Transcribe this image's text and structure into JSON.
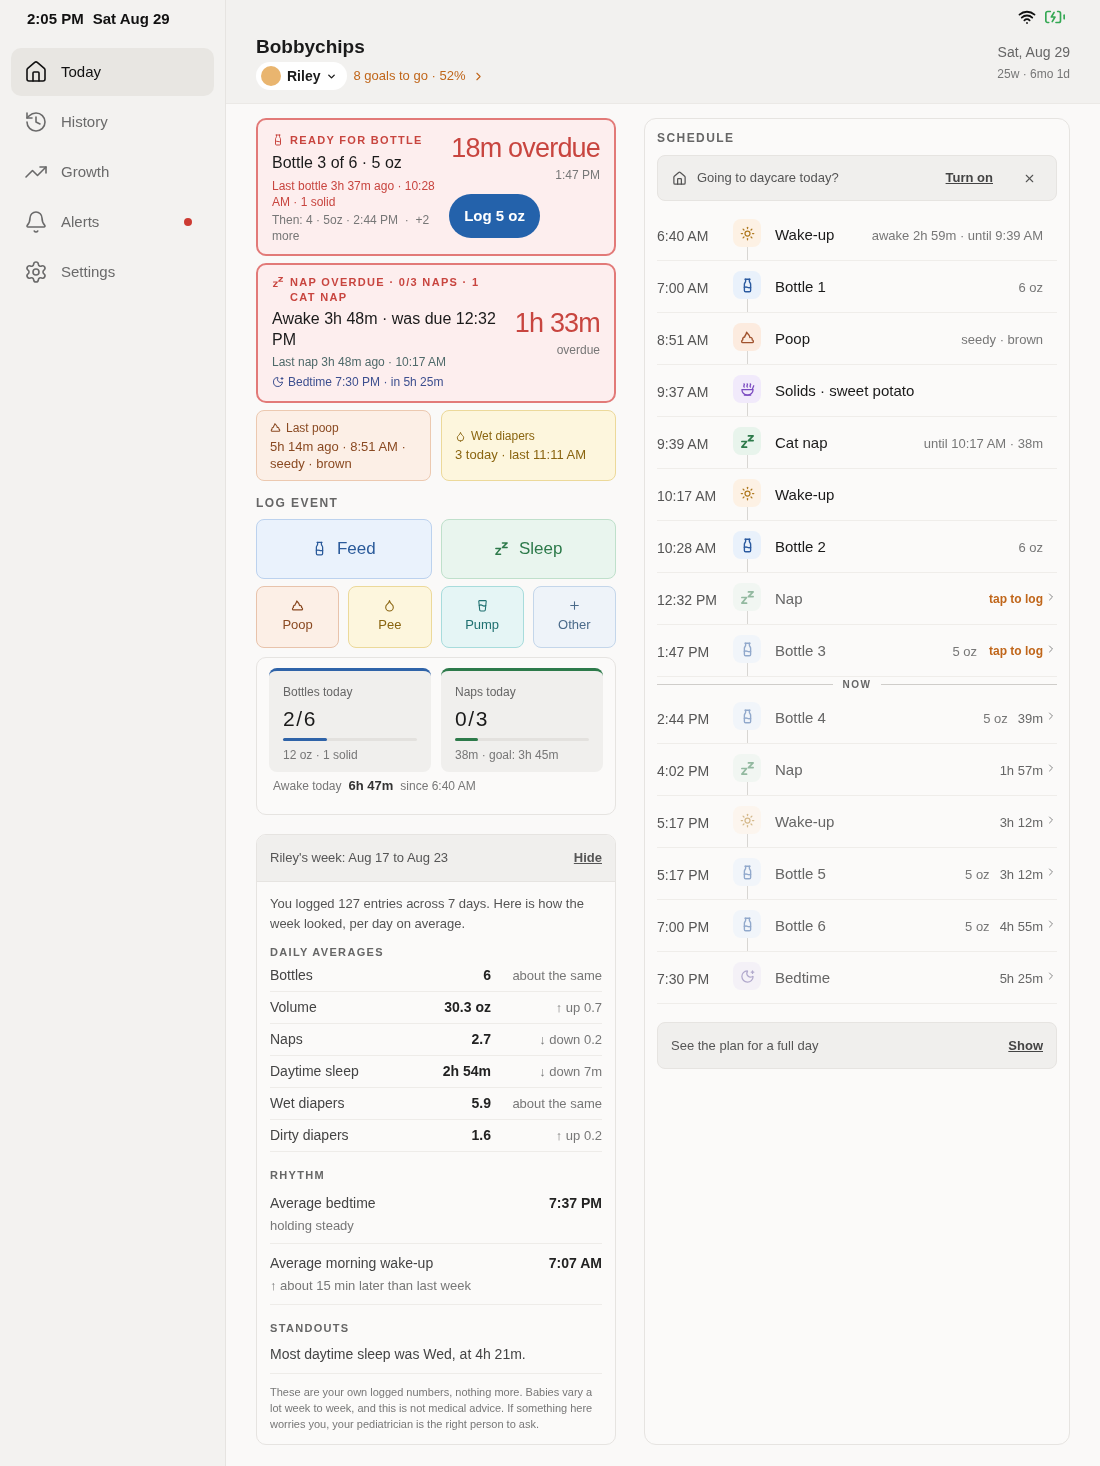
{
  "status_bar": {
    "time": "2:05 PM",
    "date": "Sat Aug 29"
  },
  "sidebar": {
    "items": [
      {
        "label": "Today",
        "selected": true,
        "alert": false
      },
      {
        "label": "History",
        "selected": false,
        "alert": false
      },
      {
        "label": "Growth",
        "selected": false,
        "alert": false
      },
      {
        "label": "Alerts",
        "selected": false,
        "alert": true
      },
      {
        "label": "Settings",
        "selected": false,
        "alert": false
      }
    ]
  },
  "header": {
    "title": "Bobbychips",
    "child": "Riley",
    "goals": "8 goals to go · 52%",
    "date": "Sat, Aug 29",
    "age": "25w · 6mo 1d"
  },
  "bottle_alert": {
    "label": "READY FOR BOTTLE",
    "title": "Bottle 3 of 6 · 5 oz",
    "detail": "Last bottle 3h 37m ago · 10:28 AM · 1 solid",
    "next": "Then: 4 · 5oz · 2:44 PM  ·  +2 more",
    "overdue": "18m overdue",
    "time": "1:47 PM",
    "button": "Log 5 oz"
  },
  "nap_alert": {
    "label": "NAP OVERDUE · 0/3 NAPS · 1 CAT NAP",
    "title": "Awake 3h 48m · was due 12:32 PM",
    "detail": "Last nap 3h 48m ago · 10:17 AM",
    "bedtime": "Bedtime 7:30 PM · in 5h 25m",
    "overdue": "1h 33m",
    "overdue_note": "overdue"
  },
  "summary_cards": [
    {
      "kind": "poop",
      "title": "Last poop",
      "text": "5h 14m ago · 8:51 AM · seedy · brown"
    },
    {
      "kind": "wet",
      "title": "Wet diapers",
      "text": "3 today · last 11:11 AM"
    }
  ],
  "log_event": {
    "heading": "LOG EVENT",
    "buttons": [
      {
        "kind": "feed",
        "label": "Feed"
      },
      {
        "kind": "sleep",
        "label": "Sleep"
      },
      {
        "kind": "poop",
        "label": "Poop"
      },
      {
        "kind": "pee",
        "label": "Pee"
      },
      {
        "kind": "pump",
        "label": "Pump"
      },
      {
        "kind": "other",
        "label": "Other"
      }
    ]
  },
  "today": {
    "tiles": [
      {
        "kind": "bottles",
        "label": "Bottles today",
        "value": "2/6",
        "level": 0.33,
        "detail": "12 oz · 1 solid"
      },
      {
        "kind": "naps",
        "label": "Naps today",
        "value": "0/3",
        "level": 0.17,
        "detail": "38m · goal: 3h 45m"
      }
    ],
    "awake_label": "Awake today",
    "awake_value": "6h 47m",
    "awake_since": "since 6:40 AM"
  },
  "week": {
    "title": "Riley's week: Aug 17 to Aug 23",
    "hide": "Hide",
    "intro": "You logged 127 entries across 7 days. Here is how the week looked, per day on average.",
    "averages_heading": "DAILY AVERAGES",
    "averages": [
      {
        "label": "Bottles",
        "value": "6",
        "change": "about the same"
      },
      {
        "label": "Volume",
        "value": "30.3 oz",
        "change": "↑ up 0.7"
      },
      {
        "label": "Naps",
        "value": "2.7",
        "change": "↓ down 0.2"
      },
      {
        "label": "Daytime sleep",
        "value": "2h 54m",
        "change": "↓ down 7m"
      },
      {
        "label": "Wet diapers",
        "value": "5.9",
        "change": "about the same"
      },
      {
        "label": "Dirty diapers",
        "value": "1.6",
        "change": "↑ up 0.2"
      }
    ],
    "rhythm_heading": "RHYTHM",
    "rhythm": [
      {
        "label": "Average bedtime",
        "note": "holding steady",
        "value": "7:37 PM"
      },
      {
        "label": "Average morning wake-up",
        "note": "↑ about 15 min later than last week",
        "value": "7:07 AM"
      }
    ],
    "standouts_heading": "STANDOUTS",
    "standout": "Most daytime sleep was Wed, at 4h 21m.",
    "disclaimer": "These are your own logged numbers, nothing more. Babies vary a lot week to week, and this is not medical advice. If something here worries you, your pediatrician is the right person to ask."
  },
  "schedule": {
    "heading": "SCHEDULE",
    "daycare": {
      "text": "Going to daycare today?",
      "action": "Turn on"
    },
    "past": [
      {
        "kind": "wake",
        "logged": true,
        "time": "6:40 AM",
        "title": "Wake-up",
        "note": "awake 2h 59m · until 9:39 AM"
      },
      {
        "kind": "bottle",
        "logged": true,
        "time": "7:00 AM",
        "title": "Bottle 1",
        "note": "6 oz"
      },
      {
        "kind": "poop",
        "logged": true,
        "time": "8:51 AM",
        "title": "Poop",
        "note": "seedy · brown"
      },
      {
        "kind": "solids",
        "logged": true,
        "time": "9:37 AM",
        "title": "Solids · sweet potato"
      },
      {
        "kind": "nap",
        "logged": true,
        "time": "9:39 AM",
        "title": "Cat nap",
        "note": "until 10:17 AM · 38m"
      },
      {
        "kind": "wake",
        "logged": true,
        "time": "10:17 AM",
        "title": "Wake-up"
      },
      {
        "kind": "bottle",
        "logged": true,
        "time": "10:28 AM",
        "title": "Bottle 2",
        "note": "6 oz"
      },
      {
        "kind": "nap",
        "logged": false,
        "time": "12:32 PM",
        "title": "Nap",
        "action": "tap to log"
      },
      {
        "kind": "bottle",
        "logged": false,
        "time": "1:47 PM",
        "title": "Bottle 3",
        "note": "5 oz",
        "action": "tap to log"
      }
    ],
    "now_label": "NOW",
    "upcoming": [
      {
        "kind": "bottle",
        "logged": false,
        "time": "2:44 PM",
        "title": "Bottle 4",
        "note": "5 oz",
        "eta": "39m"
      },
      {
        "kind": "nap",
        "logged": false,
        "time": "4:02 PM",
        "title": "Nap",
        "eta": "1h 57m"
      },
      {
        "kind": "wake",
        "logged": false,
        "time": "5:17 PM",
        "title": "Wake-up",
        "eta": "3h 12m"
      },
      {
        "kind": "bottle",
        "logged": false,
        "time": "5:17 PM",
        "title": "Bottle 5",
        "note": "5 oz",
        "eta": "3h 12m"
      },
      {
        "kind": "bottle",
        "logged": false,
        "time": "7:00 PM",
        "title": "Bottle 6",
        "note": "5 oz",
        "eta": "4h 55m"
      },
      {
        "kind": "bedtime",
        "logged": false,
        "time": "7:30 PM",
        "title": "Bedtime",
        "eta": "5h 25m"
      }
    ],
    "plan": {
      "text": "See the plan for a full day",
      "action": "Show"
    }
  }
}
